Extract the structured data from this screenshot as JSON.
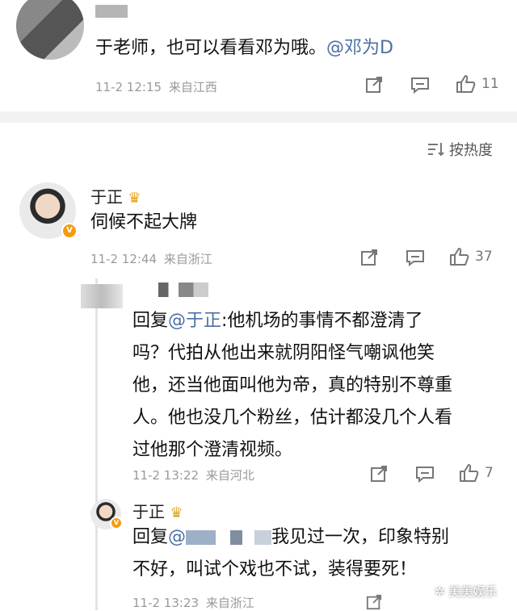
{
  "top_comment": {
    "text": "于老师，也可以看看邓为哦。",
    "mention": "@邓为D",
    "time": "11-2 12:15",
    "location": "来自江西",
    "likes": "11"
  },
  "sort": {
    "icon": "sort-icon",
    "label": "按热度"
  },
  "comment1": {
    "user": "于正",
    "text": "伺候不起大牌",
    "time": "11-2 12:44",
    "location": "来自浙江",
    "likes": "37"
  },
  "reply1": {
    "prefix": "回复",
    "mention": "@于正",
    "text_line1": ":他机场的事情不都澄清了",
    "text_line2": "吗？代拍从他出来就阴阳怪气嘲讽他笑",
    "text_line3": "他，还当他面叫他为帝，真的特别不尊重",
    "text_line4": "人。他也没几个粉丝，估计都没几个人看",
    "text_line5": "过他那个澄清视频。",
    "time": "11-2 13:22",
    "location": "来自河北",
    "likes": "7"
  },
  "reply2": {
    "user": "于正",
    "prefix": "回复",
    "mention": "@",
    "text_line1": "我见过一次，印象特别",
    "text_line2": "不好，叫试个戏也不试，装得要死！",
    "time": "11-2 13:23",
    "location": "来自浙江"
  },
  "watermark": "美美娱乐",
  "colors": {
    "mention": "#4a6fa5",
    "verified_badge": "#f39c12",
    "crown": "#e2a31a"
  }
}
